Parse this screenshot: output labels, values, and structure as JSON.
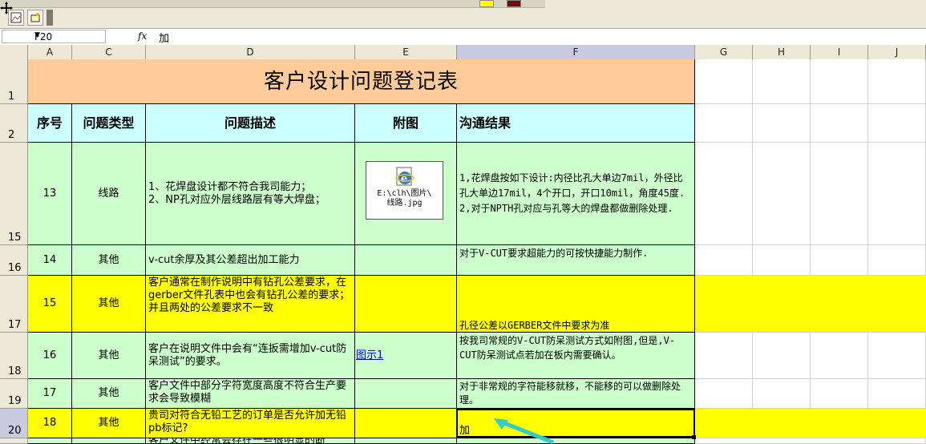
{
  "name_box": "F20",
  "fx_label": "fx",
  "formula_value": "加",
  "columns": [
    "A",
    "C",
    "D",
    "E",
    "F",
    "G",
    "H",
    "I",
    "J"
  ],
  "rows": [
    "1",
    "2",
    "15",
    "16",
    "17",
    "18",
    "19",
    "20"
  ],
  "title": "客户设计问题登记表",
  "headers": {
    "no": "序号",
    "type": "问题类型",
    "desc": "问题描述",
    "attach": "附图",
    "result": "沟通结果"
  },
  "embed_caption_1": "E:\\clh\\图片\\",
  "embed_caption_2": "线路.jpg",
  "data_rows": [
    {
      "no": "13",
      "type": "线路",
      "desc": "1、花焊盘设计都不符合我司能力；\n2、NP孔对应外层线路层有等大焊盘；",
      "attach": "",
      "result": "1,花焊盘按如下设计:内径比孔大单边7mil，外径比孔大单边17mil，4个开口，开口10mil，角度45度.\n2,对于NPTH孔对应与孔等大的焊盘都做删除处理."
    },
    {
      "no": "14",
      "type": "其他",
      "desc": "v-cut余厚及其公差超出加工能力",
      "attach": "",
      "result": "对于V-CUT要求超能力的可按快捷能力制作."
    },
    {
      "no": "15",
      "type": "其他",
      "desc": "客户通常在制作说明中有钻孔公差要求，在gerber文件孔表中也会有钻孔公差的要求；并且两处的公差要求不一致",
      "attach": "",
      "result": "孔径公差以GERBER文件中要求为准"
    },
    {
      "no": "16",
      "type": "其他",
      "desc": "客户在说明文件中会有“连扳需增加v-cut防呆测试”的要求。",
      "attach": "图示1",
      "result": "按我司常规的V-CUT防呆测试方式如附图,但是,V-CUT防呆测试点若加在板内需要确认。"
    },
    {
      "no": "17",
      "type": "其他",
      "desc": "客户文件中部分字符宽度高度不符合生产要求会导致模糊",
      "attach": "",
      "result": "对于非常规的字符能移就移，不能移的可以做删除处理。"
    },
    {
      "no": "18",
      "type": "其他",
      "desc": "贵司对符合无铅工艺的订单是否允许加无铅pb标记?",
      "attach": "",
      "result": "加"
    }
  ],
  "next_row_partial": "客户文件中经常会存在一些很明显的断",
  "colors": {
    "title_bg": "#ffcc99",
    "header_bg": "#ccffff",
    "green_bg": "#ccffcc",
    "yellow_bg": "#ffff00",
    "arrow": "#33cccc"
  }
}
